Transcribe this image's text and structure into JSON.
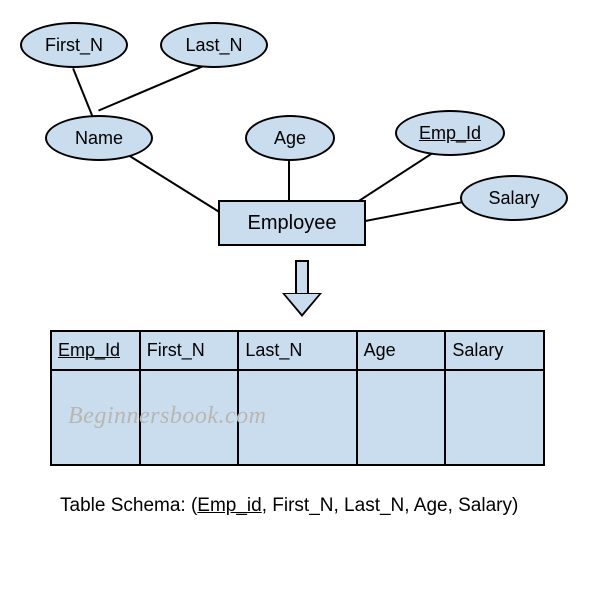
{
  "er": {
    "first_n": "First_N",
    "last_n": "Last_N",
    "name": "Name",
    "age": "Age",
    "emp_id": "Emp_Id",
    "salary": "Salary",
    "entity": "Employee"
  },
  "table": {
    "headers": {
      "emp_id": "Emp_Id ",
      "first_n": "First_N",
      "last_n": "Last_N",
      "age": "Age",
      "salary": "Salary"
    }
  },
  "watermark": "Beginnersbook.com",
  "schema": {
    "prefix": "Table Schema: (",
    "pk": "Emp_id",
    "rest": ", First_N, Last_N, Age, Salary)"
  }
}
